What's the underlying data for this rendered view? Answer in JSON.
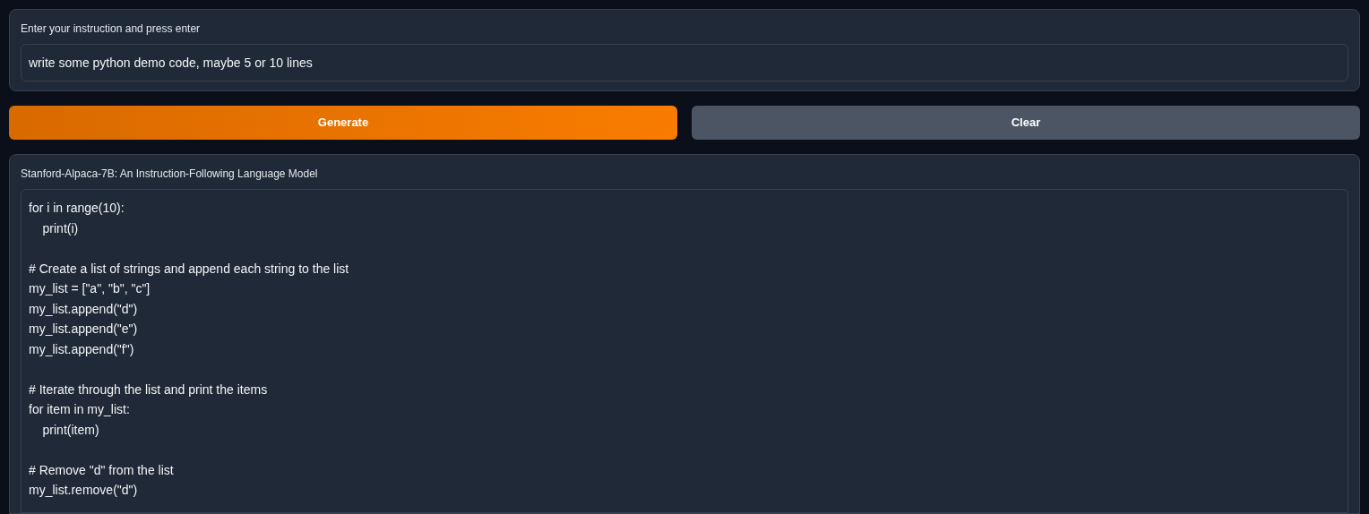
{
  "instruction": {
    "label": "Enter your instruction and press enter",
    "value": "write some python demo code, maybe 5 or 10 lines"
  },
  "buttons": [
    {
      "label": "Generate",
      "kind": "primary"
    },
    {
      "label": "Clear",
      "kind": "secondary"
    }
  ],
  "output": {
    "label": "Stanford-Alpaca-7B: An Instruction-Following Language Model",
    "value": "for i in range(10):\n    print(i)\n\n# Create a list of strings and append each string to the list\nmy_list = [\"a\", \"b\", \"c\"]\nmy_list.append(\"d\")\nmy_list.append(\"e\")\nmy_list.append(\"f\")\n\n# Iterate through the list and print the items\nfor item in my_list:\n    print(item)\n\n# Remove \"d\" from the list\nmy_list.remove(\"d\")"
  }
}
